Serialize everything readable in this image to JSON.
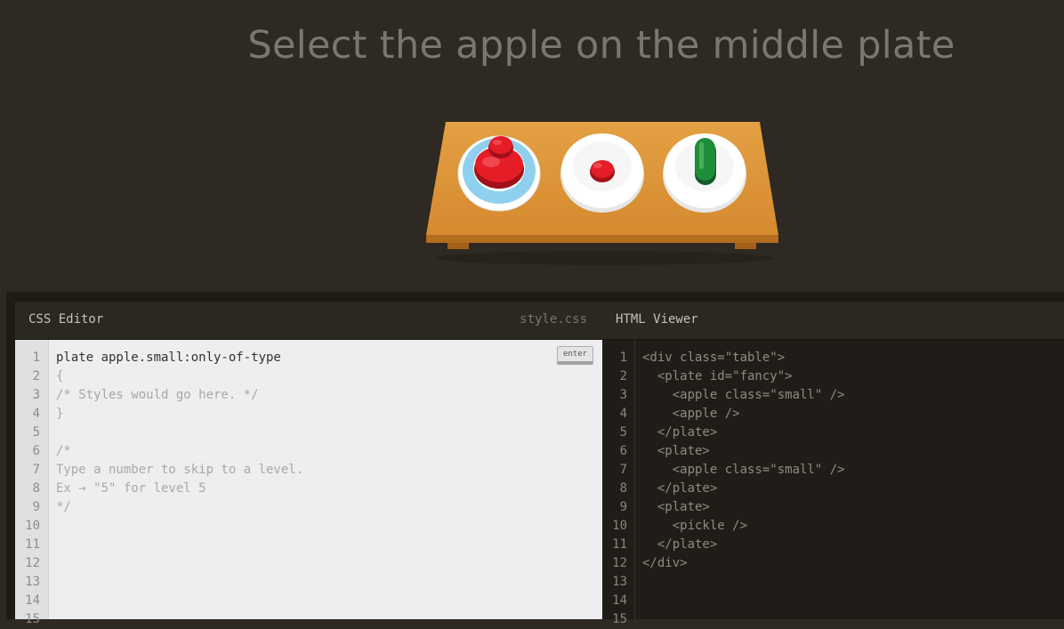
{
  "instruction": "Select the apple on the middle plate",
  "css_editor": {
    "title": "CSS Editor",
    "filename": "style.css",
    "enter_label": "enter",
    "line_numbers": [
      "1",
      "2",
      "3",
      "4",
      "5",
      "6",
      "7",
      "8",
      "9",
      "10",
      "11",
      "12",
      "13",
      "14",
      "15"
    ],
    "input_line": "plate apple.small:only-of-type",
    "lines": [
      "{",
      "/* Styles would go here. */",
      "}",
      "",
      "/*",
      "Type a number to skip to a level.",
      "Ex → \"5\" for level 5",
      "*/"
    ]
  },
  "html_viewer": {
    "title": "HTML Viewer",
    "line_numbers": [
      "1",
      "2",
      "3",
      "4",
      "5",
      "6",
      "7",
      "8",
      "9",
      "10",
      "11",
      "12",
      "13",
      "14",
      "15"
    ],
    "lines": [
      "<div class=\"table\">",
      "  <plate id=\"fancy\">",
      "    <apple class=\"small\" />",
      "    <apple />",
      "  </plate>",
      "  <plate>",
      "    <apple class=\"small\" />",
      "  </plate>",
      "  <plate>",
      "    <pickle />",
      "  </plate>",
      "</div>"
    ]
  },
  "colors": {
    "background": "#2e2922",
    "table": "#e09a40",
    "apple": "#e41d26",
    "pickle": "#1f8c3a",
    "fancy_plate_rim": "#8fd0ee"
  }
}
